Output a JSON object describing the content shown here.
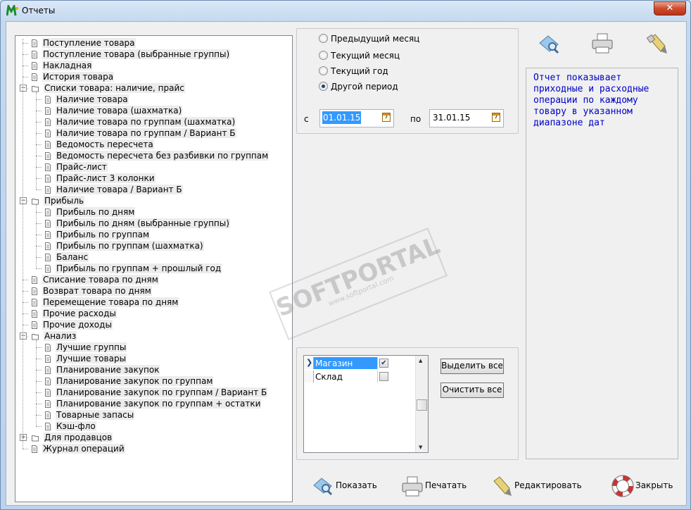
{
  "window": {
    "title": "Отчеты",
    "close_glyph": "✕"
  },
  "tree": [
    {
      "label": "Поступление товара",
      "level": 0,
      "icon": "doc-icon"
    },
    {
      "label": "Поступление товара (выбранные группы)",
      "level": 0,
      "icon": "doc-icon"
    },
    {
      "label": "Накладная",
      "level": 0,
      "icon": "doc-icon"
    },
    {
      "label": "История товара",
      "level": 0,
      "icon": "doc-icon"
    },
    {
      "label": "Списки товара: наличие, прайс",
      "level": 0,
      "icon": "folder-icon",
      "expander": "−"
    },
    {
      "label": "Наличие товара",
      "level": 1,
      "icon": "doc-icon"
    },
    {
      "label": "Наличие товара (шахматка)",
      "level": 1,
      "icon": "doc-icon"
    },
    {
      "label": "Наличие товара по группам (шахматка)",
      "level": 1,
      "icon": "doc-icon"
    },
    {
      "label": "Наличие товара по группам / Вариант Б",
      "level": 1,
      "icon": "doc-icon"
    },
    {
      "label": "Ведомость пересчета",
      "level": 1,
      "icon": "doc-icon"
    },
    {
      "label": "Ведомость пересчета без разбивки по группам",
      "level": 1,
      "icon": "doc-icon"
    },
    {
      "label": "Прайс-лист",
      "level": 1,
      "icon": "doc-icon"
    },
    {
      "label": "Прайс-лист 3 колонки",
      "level": 1,
      "icon": "doc-icon"
    },
    {
      "label": "Наличие товара / Вариант Б",
      "level": 1,
      "icon": "doc-icon"
    },
    {
      "label": "Прибыль",
      "level": 0,
      "icon": "folder-icon",
      "expander": "−"
    },
    {
      "label": "Прибыль по дням",
      "level": 1,
      "icon": "doc-icon"
    },
    {
      "label": "Прибыль по дням (выбранные группы)",
      "level": 1,
      "icon": "doc-icon"
    },
    {
      "label": "Прибыль по группам",
      "level": 1,
      "icon": "doc-icon"
    },
    {
      "label": "Прибыль по группам (шахматка)",
      "level": 1,
      "icon": "doc-icon"
    },
    {
      "label": "Баланс",
      "level": 1,
      "icon": "doc-icon"
    },
    {
      "label": "Прибыль по группам + прошлый год",
      "level": 1,
      "icon": "doc-icon"
    },
    {
      "label": "Списание товара по дням",
      "level": 0,
      "icon": "doc-icon"
    },
    {
      "label": "Возврат товара по дням",
      "level": 0,
      "icon": "doc-icon"
    },
    {
      "label": "Перемещение товара по дням",
      "level": 0,
      "icon": "doc-icon"
    },
    {
      "label": "Прочие расходы",
      "level": 0,
      "icon": "doc-icon"
    },
    {
      "label": "Прочие доходы",
      "level": 0,
      "icon": "doc-icon"
    },
    {
      "label": "Анализ",
      "level": 0,
      "icon": "folder-icon",
      "expander": "−"
    },
    {
      "label": "Лучшие группы",
      "level": 1,
      "icon": "doc-icon"
    },
    {
      "label": "Лучшие товары",
      "level": 1,
      "icon": "doc-icon"
    },
    {
      "label": "Планирование закупок",
      "level": 1,
      "icon": "doc-icon"
    },
    {
      "label": "Планирование закупок по группам",
      "level": 1,
      "icon": "doc-icon"
    },
    {
      "label": "Планирование закупок по группам / Вариант Б",
      "level": 1,
      "icon": "doc-icon"
    },
    {
      "label": "Планирование закупок по группам + остатки",
      "level": 1,
      "icon": "doc-icon"
    },
    {
      "label": "Товарные запасы",
      "level": 1,
      "icon": "doc-icon"
    },
    {
      "label": "Кэш-фло",
      "level": 1,
      "icon": "doc-icon"
    },
    {
      "label": "Для продавцов",
      "level": 0,
      "icon": "folder-icon",
      "expander": "+"
    },
    {
      "label": "Журнал операций",
      "level": 0,
      "icon": "doc-icon"
    }
  ],
  "period": {
    "options": [
      "Предыдущий месяц",
      "Текущий месяц",
      "Текущий год",
      "Другой период"
    ],
    "selected_index": 3,
    "from_label": "с",
    "from_value": "01.01.15",
    "to_label": "по",
    "to_value": "31.01.15",
    "calendar_glyph": "7"
  },
  "stores": {
    "rows": [
      {
        "name": "Магазин",
        "checked": true
      },
      {
        "name": "Склад",
        "checked": false
      }
    ],
    "select_all_label": "Выделить все",
    "clear_all_label": "Очистить все"
  },
  "description": "Отчет показывает приходные и расходные операции по каждому товару в указанном диапазоне дат",
  "bottom": {
    "show_label": "Показать",
    "print_label": "Печатать",
    "edit_label": "Редактировать",
    "close_label": "Закрыть"
  },
  "watermark": {
    "brand": "SOFTPORTAL",
    "url": "www.softportal.com",
    "tm": "TM"
  },
  "colors": {
    "description_text": "#0000c8",
    "selection": "#3399ff"
  }
}
